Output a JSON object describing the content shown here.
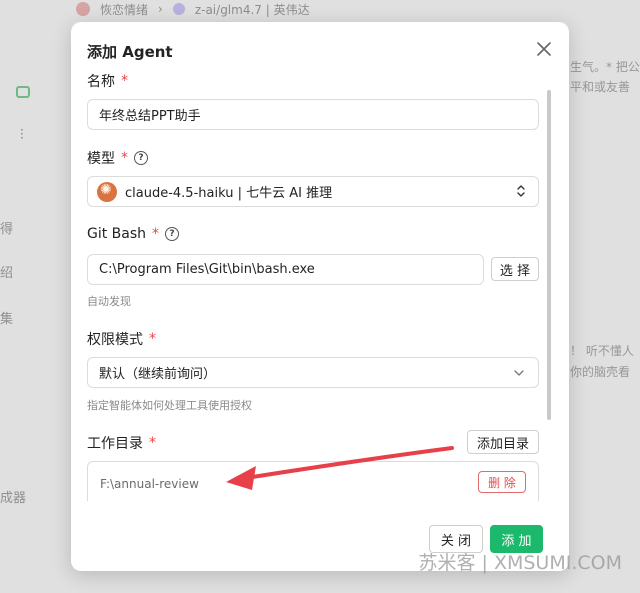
{
  "background": {
    "breadcrumb_chat": "恢恋情绪",
    "breadcrumb_model": "z-ai/glm4.7 | 英伟达",
    "side_texts": [
      "得",
      "绍",
      "集",
      "成器"
    ],
    "right_texts": [
      "生气。* 把公",
      "平和或友善",
      "！ 听不懂人",
      "你的脑壳看"
    ]
  },
  "modal": {
    "title": "添加 Agent",
    "name": {
      "label": "名称",
      "required": "*",
      "value": "年终总结PPT助手"
    },
    "model": {
      "label": "模型",
      "required": "*",
      "help": "?",
      "value": "claude-4.5-haiku | 七牛云 AI 推理"
    },
    "git_bash": {
      "label": "Git Bash",
      "required": "*",
      "help": "?",
      "value": "C:\\Program Files\\Git\\bin\\bash.exe",
      "choose_label": "选 择",
      "hint": "自动发现"
    },
    "permission": {
      "label": "权限模式",
      "required": "*",
      "value": "默认（继续前询问）",
      "hint": "指定智能体如何处理工具使用授权"
    },
    "workdir": {
      "label": "工作目录",
      "required": "*",
      "add_label": "添加目录",
      "path": "F:\\annual-review",
      "delete_label": "删 除"
    },
    "footer": {
      "cancel_label": "关 闭",
      "add_label": "添 加"
    }
  },
  "watermark": "苏米客 | XMSUMI.COM",
  "colors": {
    "primary_green": "#1cb86b",
    "danger_red": "#e24c4c",
    "annotation_red": "#e8404a"
  }
}
